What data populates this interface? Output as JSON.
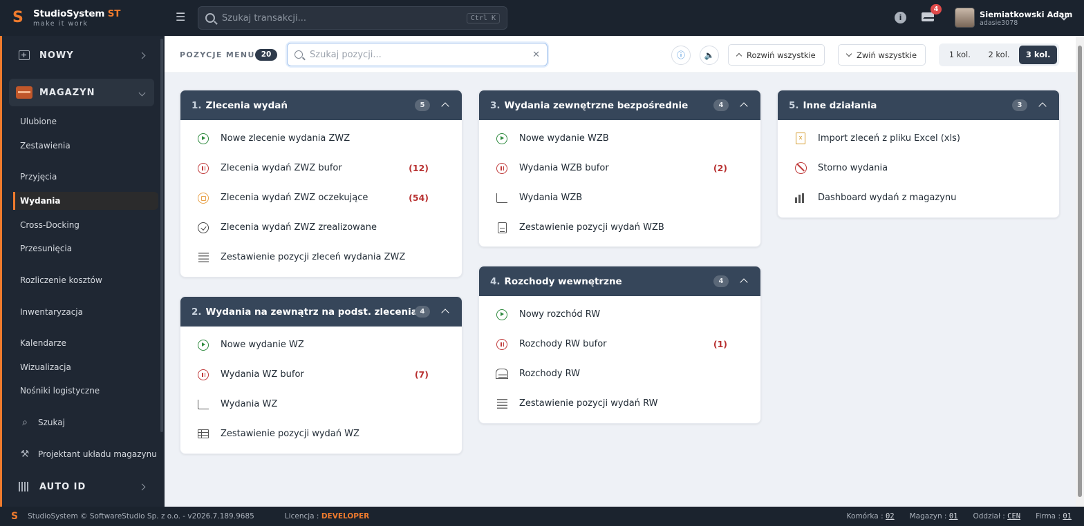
{
  "brand": {
    "name": "StudioSystem",
    "suffix": "ST",
    "tagline": "make it work"
  },
  "topbar": {
    "search_placeholder": "Szukaj transakcji...",
    "shortcut": "Ctrl K",
    "mail_badge": "4",
    "user_name": "Siemiatkowski Adam",
    "user_login": "adasie3078"
  },
  "sidebar": {
    "nowy": "NOWY",
    "magazyn": "MAGAZYN",
    "items": [
      "Ulubione",
      "Zestawienia",
      "Przyjęcia",
      "Wydania",
      "Cross-Docking",
      "Przesunięcia",
      "Rozliczenie kosztów",
      "Inwentaryzacja",
      "Kalendarze",
      "Wizualizacja",
      "Nośniki logistyczne"
    ],
    "szukaj": "Szukaj",
    "projektant": "Projektant układu magazynu",
    "autoid": "AUTO ID"
  },
  "toolbar": {
    "label": "POZYCJE MENU",
    "count": "20",
    "search_placeholder": "Szukaj pozycji...",
    "expand_all": "Rozwiń wszystkie",
    "collapse_all": "Zwiń wszystkie",
    "col1": "1 kol.",
    "col2": "2 kol.",
    "col3": "3 kol."
  },
  "cards": [
    {
      "num": "1.",
      "title": "Zlecenia wydań",
      "count": "5",
      "rows": [
        {
          "label": "Nowe zlecenie wydania ZWZ",
          "count": "",
          "icon": "play-icon"
        },
        {
          "label": "Zlecenia wydań ZWZ bufor",
          "count": "(12)",
          "icon": "pause-icon"
        },
        {
          "label": "Zlecenia wydań ZWZ oczekujące",
          "count": "(54)",
          "icon": "waiting-icon"
        },
        {
          "label": "Zlecenia wydań ZWZ zrealizowane",
          "count": "",
          "icon": "check-icon"
        },
        {
          "label": "Zestawienie pozycji zleceń wydania ZWZ",
          "count": "",
          "icon": "list-icon"
        }
      ]
    },
    {
      "num": "2.",
      "title": "Wydania na zewnątrz na podst. zlecenia",
      "count": "4",
      "rows": [
        {
          "label": "Nowe wydanie WZ",
          "count": "",
          "icon": "play-icon"
        },
        {
          "label": "Wydania WZ bufor",
          "count": "(7)",
          "icon": "pause-icon"
        },
        {
          "label": "Wydania WZ",
          "count": "",
          "icon": "cart-icon"
        },
        {
          "label": "Zestawienie pozycji wydań WZ",
          "count": "",
          "icon": "table-icon"
        }
      ]
    },
    {
      "num": "3.",
      "title": "Wydania zewnętrzne bezpośrednie",
      "count": "4",
      "rows": [
        {
          "label": "Nowe wydanie WZB",
          "count": "",
          "icon": "play-icon"
        },
        {
          "label": "Wydania WZB bufor",
          "count": "(2)",
          "icon": "pause-icon"
        },
        {
          "label": "Wydania WZB",
          "count": "",
          "icon": "cart-icon"
        },
        {
          "label": "Zestawienie pozycji wydań WZB",
          "count": "",
          "icon": "clipboard-icon"
        }
      ]
    },
    {
      "num": "4.",
      "title": "Rozchody wewnętrzne",
      "count": "4",
      "rows": [
        {
          "label": "Nowy rozchód RW",
          "count": "",
          "icon": "play-icon"
        },
        {
          "label": "Rozchody RW bufor",
          "count": "(1)",
          "icon": "pause-icon"
        },
        {
          "label": "Rozchody RW",
          "count": "",
          "icon": "warehouse-icon"
        },
        {
          "label": "Zestawienie pozycji wydań RW",
          "count": "",
          "icon": "list-icon"
        }
      ]
    },
    {
      "num": "5.",
      "title": "Inne działania",
      "count": "3",
      "rows": [
        {
          "label": "Import zleceń z pliku Excel (xls)",
          "count": "",
          "icon": "excel-icon"
        },
        {
          "label": "Storno wydania",
          "count": "",
          "icon": "ban-icon"
        },
        {
          "label": "Dashboard wydań z magazynu",
          "count": "",
          "icon": "bar-chart-icon"
        }
      ]
    }
  ],
  "footer": {
    "copyright": "StudioSystem © SoftwareStudio Sp. z o.o. - v2026.7.189.9685",
    "license_label": "Licencja :",
    "license_value": "DEVELOPER",
    "komorka_label": "Komórka :",
    "komorka": "02",
    "magazyn_label": "Magazyn :",
    "magazyn": "01",
    "oddzial_label": "Oddział :",
    "oddzial": "CEN",
    "firma_label": "Firma :",
    "firma": "01"
  },
  "colors": {
    "accent": "#f07b2d",
    "header": "#36465a",
    "danger": "#b83030",
    "success": "#2e8a3e"
  }
}
